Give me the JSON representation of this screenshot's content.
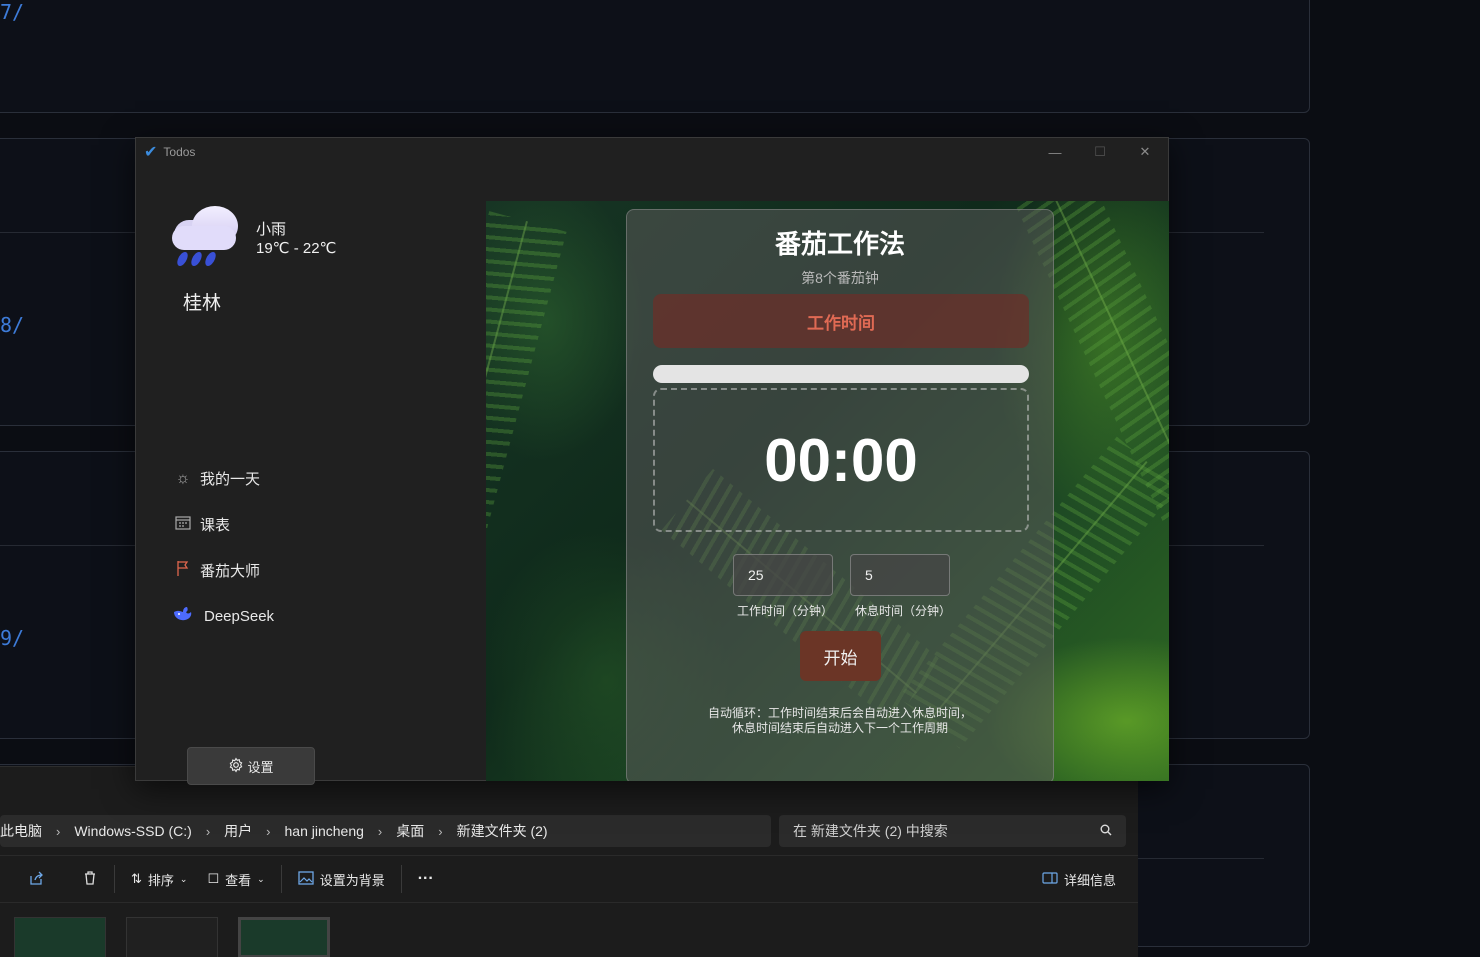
{
  "background": {
    "numbers": [
      "7/",
      "8/",
      "9/"
    ]
  },
  "window": {
    "title": "Todos",
    "controls": {
      "minimize": "—",
      "maximize": "☐",
      "close": "✕"
    }
  },
  "weather": {
    "condition": "小雨",
    "temperature": "19℃ - 22℃",
    "city": "桂林"
  },
  "sidebar": {
    "items": [
      {
        "label": "我的一天",
        "icon": "sun-icon"
      },
      {
        "label": "课表",
        "icon": "calendar-icon"
      },
      {
        "label": "番茄大师",
        "icon": "flag-icon"
      },
      {
        "label": "DeepSeek",
        "icon": "whale-icon"
      }
    ],
    "settings_label": "设置"
  },
  "pomodoro": {
    "title": "番茄工作法",
    "subtitle": "第8个番茄钟",
    "phase": "工作时间",
    "progress": 0,
    "timer": "00:00",
    "work_minutes": "25",
    "break_minutes": "5",
    "work_label": "工作时间（分钟）",
    "break_label": "休息时间（分钟）",
    "start_label": "开始",
    "note_line1": "自动循环：工作时间结束后会自动进入休息时间，",
    "note_line2": "休息时间结束后自动进入下一个工作周期"
  },
  "explorer": {
    "breadcrumb": [
      "此电脑",
      "Windows-SSD (C:)",
      "用户",
      "han jincheng",
      "桌面",
      "新建文件夹 (2)"
    ],
    "search_placeholder": "在 新建文件夹 (2) 中搜索",
    "toolbar": {
      "sort": "排序",
      "view": "查看",
      "set_background": "设置为背景",
      "more": "···",
      "details": "详细信息"
    }
  },
  "colors": {
    "accent": "#e06a54",
    "start_button": "#6b3526",
    "title_check": "#3b8bdc",
    "bg_link": "#3d7bd8"
  }
}
